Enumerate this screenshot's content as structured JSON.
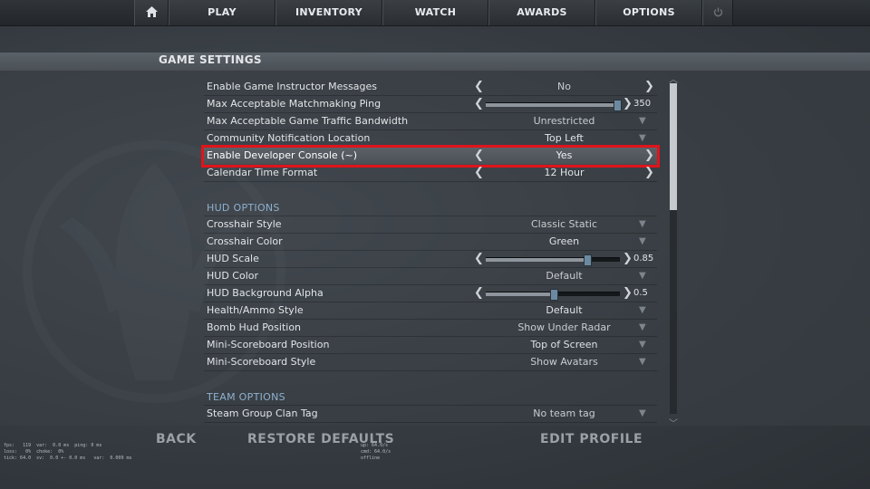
{
  "nav": {
    "items": [
      "PLAY",
      "INVENTORY",
      "WATCH",
      "AWARDS",
      "OPTIONS"
    ],
    "home_icon": "home-icon",
    "power_icon": "power-icon"
  },
  "title": "GAME SETTINGS",
  "game_settings": [
    {
      "label": "Enable Game Instructor Messages",
      "value": "No",
      "control": "arrows"
    },
    {
      "label": "Max Acceptable Matchmaking Ping",
      "value": "350",
      "control": "slider",
      "level": 0.97
    },
    {
      "label": "Max Acceptable Game Traffic Bandwidth",
      "value": "Unrestricted",
      "control": "dropdown"
    },
    {
      "label": "Community Notification Location",
      "value": "Top Left",
      "control": "dropdown"
    },
    {
      "label": "Enable Developer Console (~)",
      "value": "Yes",
      "control": "arrows",
      "highlighted": true
    },
    {
      "label": "Calendar Time Format",
      "value": "12 Hour",
      "control": "arrows"
    }
  ],
  "hud_options": {
    "heading": "HUD OPTIONS",
    "items": [
      {
        "label": "Crosshair Style",
        "value": "Classic Static",
        "control": "dropdown"
      },
      {
        "label": "Crosshair Color",
        "value": "Green",
        "control": "dropdown"
      },
      {
        "label": "HUD Scale",
        "value": "0.85",
        "control": "slider",
        "level": 0.75
      },
      {
        "label": "HUD Color",
        "value": "Default",
        "control": "dropdown"
      },
      {
        "label": "HUD Background Alpha",
        "value": "0.5",
        "control": "slider",
        "level": 0.5
      },
      {
        "label": "Health/Ammo Style",
        "value": "Default",
        "control": "dropdown"
      },
      {
        "label": "Bomb Hud Position",
        "value": "Show Under Radar",
        "control": "dropdown"
      },
      {
        "label": "Mini-Scoreboard Position",
        "value": "Top of Screen",
        "control": "dropdown"
      },
      {
        "label": "Mini-Scoreboard Style",
        "value": "Show Avatars",
        "control": "dropdown"
      }
    ]
  },
  "team_options": {
    "heading": "TEAM OPTIONS",
    "items": [
      {
        "label": "Steam Group Clan Tag",
        "value": "No team tag",
        "control": "dropdown"
      }
    ]
  },
  "bottom": {
    "back": "BACK",
    "restore": "RESTORE DEFAULTS",
    "edit_profile": "EDIT PROFILE"
  },
  "netgraph": {
    "left": "fps:   119  var:  0.0 ms  ping: 0 ms\nloss:   0%  choke:  0%\ntick: 64.0  sv:  0.0 +- 0.0 ms   var:  0.000 ms",
    "right": "up: 64.0/s\ncmd: 64.0/s\noffline"
  },
  "colors": {
    "highlight_outline": "#e0141c",
    "section_heading": "#8fb0cf",
    "slider_knob": "#6b8aa2"
  }
}
